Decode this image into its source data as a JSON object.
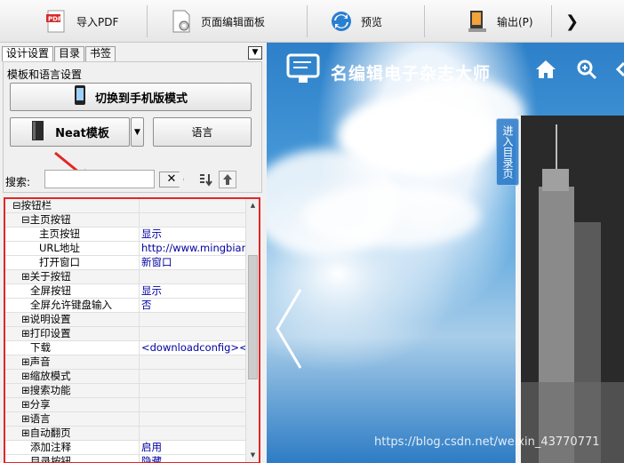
{
  "toolbar": {
    "import_pdf": "导入PDF",
    "page_editor": "页面编辑面板",
    "preview": "预览",
    "output": "输出(P)",
    "more": "❯"
  },
  "left_panel": {
    "tabs": [
      "设计设置",
      "目录",
      "书签"
    ],
    "group_title": "模板和语言设置",
    "switch_mobile": "切换到手机版模式",
    "template": "Neat模板",
    "language": "语言",
    "search_label": "搜索:",
    "search_value": "",
    "clear": "✕"
  },
  "property_grid": {
    "rows": [
      {
        "key": "⊟按钮栏",
        "value": "",
        "indent": 0,
        "cat": true
      },
      {
        "key": "⊟主页按钮",
        "value": "",
        "indent": 1,
        "cat": true
      },
      {
        "key": "主页按钮",
        "value": "显示",
        "indent": 3
      },
      {
        "key": "URL地址",
        "value": "http://www.mingbianj...",
        "indent": 3
      },
      {
        "key": "打开窗口",
        "value": "新窗口",
        "indent": 3
      },
      {
        "key": "⊞关于按钮",
        "value": "",
        "indent": 1,
        "cat": true
      },
      {
        "key": "全屏按钮",
        "value": "显示",
        "indent": 2
      },
      {
        "key": "全屏允许键盘输入",
        "value": "否",
        "indent": 2
      },
      {
        "key": "⊞说明设置",
        "value": "",
        "indent": 1,
        "cat": true
      },
      {
        "key": "⊞打印设置",
        "value": "",
        "indent": 1,
        "cat": true
      },
      {
        "key": "下载",
        "value": "<downloadconfig><u...",
        "indent": 2
      },
      {
        "key": "⊞声音",
        "value": "",
        "indent": 1,
        "cat": true
      },
      {
        "key": "⊞缩放模式",
        "value": "",
        "indent": 1,
        "cat": true
      },
      {
        "key": "⊞搜索功能",
        "value": "",
        "indent": 1,
        "cat": true
      },
      {
        "key": "⊞分享",
        "value": "",
        "indent": 1,
        "cat": true
      },
      {
        "key": "⊞语言",
        "value": "",
        "indent": 1,
        "cat": true
      },
      {
        "key": "⊞自动翻页",
        "value": "",
        "indent": 1,
        "cat": true
      },
      {
        "key": "添加注释",
        "value": "启用",
        "indent": 2
      },
      {
        "key": "目录按钮",
        "value": "隐藏",
        "indent": 2
      }
    ]
  },
  "preview": {
    "title": "名编辑电子杂志大师",
    "side_tab": "进入目录页",
    "watermark": "https://blog.csdn.net/weixin_43770771"
  },
  "colors": {
    "highlight_border": "#e32626",
    "value_text": "#0000a0",
    "sky": "#4ea0dc"
  }
}
